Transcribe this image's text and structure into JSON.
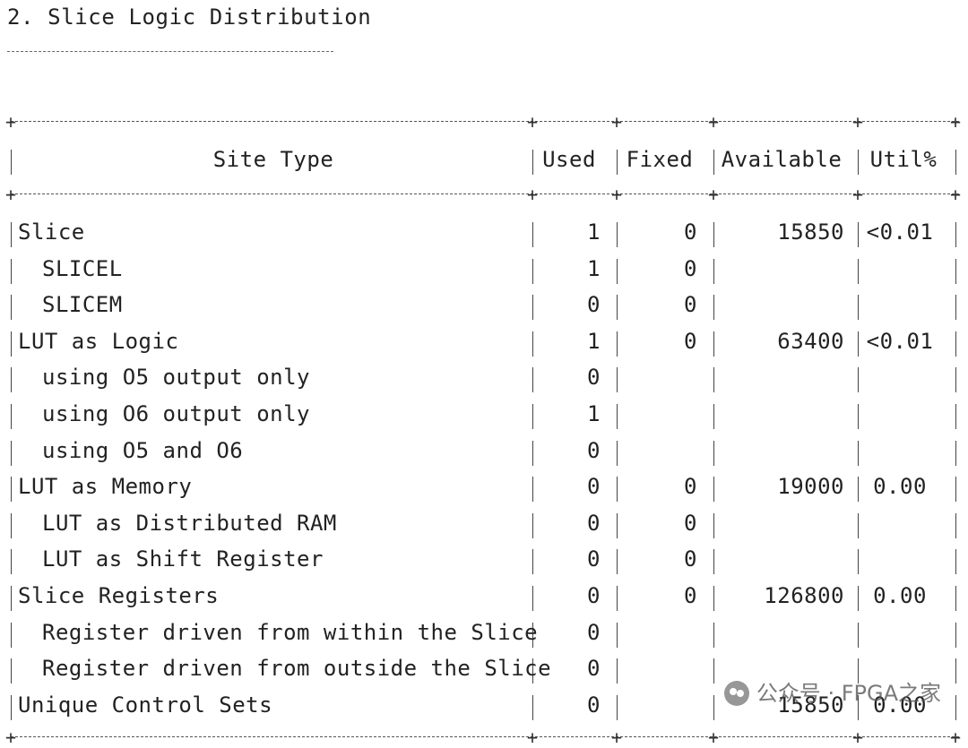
{
  "header": {
    "title": "2. Slice Logic Distribution",
    "underline": "--------------------------"
  },
  "table": {
    "columns": [
      "Site Type",
      "Used",
      "Fixed",
      "Available",
      "Util%"
    ],
    "rows": [
      {
        "site_type": "Slice",
        "used": "1",
        "fixed": "0",
        "available": "15850",
        "util": "<0.01",
        "indent": false
      },
      {
        "site_type": "SLICEL",
        "used": "1",
        "fixed": "0",
        "available": "",
        "util": "",
        "indent": true
      },
      {
        "site_type": "SLICEM",
        "used": "0",
        "fixed": "0",
        "available": "",
        "util": "",
        "indent": true
      },
      {
        "site_type": "LUT as Logic",
        "used": "1",
        "fixed": "0",
        "available": "63400",
        "util": "<0.01",
        "indent": false
      },
      {
        "site_type": "using O5 output only",
        "used": "0",
        "fixed": "",
        "available": "",
        "util": "",
        "indent": true
      },
      {
        "site_type": "using O6 output only",
        "used": "1",
        "fixed": "",
        "available": "",
        "util": "",
        "indent": true
      },
      {
        "site_type": "using O5 and O6",
        "used": "0",
        "fixed": "",
        "available": "",
        "util": "",
        "indent": true
      },
      {
        "site_type": "LUT as Memory",
        "used": "0",
        "fixed": "0",
        "available": "19000",
        "util": "0.00",
        "indent": false
      },
      {
        "site_type": "LUT as Distributed RAM",
        "used": "0",
        "fixed": "0",
        "available": "",
        "util": "",
        "indent": true
      },
      {
        "site_type": "LUT as Shift Register",
        "used": "0",
        "fixed": "0",
        "available": "",
        "util": "",
        "indent": true
      },
      {
        "site_type": "Slice Registers",
        "used": "0",
        "fixed": "0",
        "available": "126800",
        "util": "0.00",
        "indent": false
      },
      {
        "site_type": "Register driven from within the Slice",
        "used": "0",
        "fixed": "",
        "available": "",
        "util": "",
        "indent": true
      },
      {
        "site_type": "Register driven from outside the Slice",
        "used": "0",
        "fixed": "",
        "available": "",
        "util": "",
        "indent": true
      },
      {
        "site_type": "Unique Control Sets",
        "used": "0",
        "fixed": "",
        "available": "15850",
        "util": "0.00",
        "indent": false
      }
    ]
  },
  "watermark": {
    "text": "公众号 · FPGA之家",
    "icon": "wechat-icon"
  }
}
